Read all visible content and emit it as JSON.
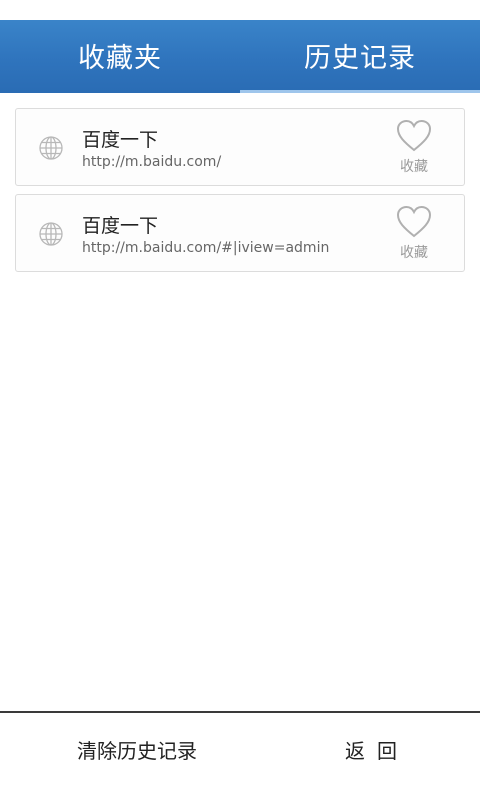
{
  "tabs": [
    {
      "label": "收藏夹",
      "active": false
    },
    {
      "label": "历史记录",
      "active": true
    }
  ],
  "history": [
    {
      "title": "百度一下",
      "url": "http://m.baidu.com/",
      "icon": "globe-icon",
      "fav_label": "收藏",
      "fav_icon": "heart-outline-icon"
    },
    {
      "title": "百度一下",
      "url": "http://m.baidu.com/#|iview=admin",
      "icon": "globe-icon",
      "fav_label": "收藏",
      "fav_icon": "heart-outline-icon"
    }
  ],
  "bottom": {
    "clear_label": "清除历史记录",
    "back_label": "返回"
  },
  "colors": {
    "header": "#2f74bd",
    "tab_indicator": "#9fc6ec",
    "card_border": "#dcdcdc",
    "icon_gray": "#b8b8b8"
  }
}
